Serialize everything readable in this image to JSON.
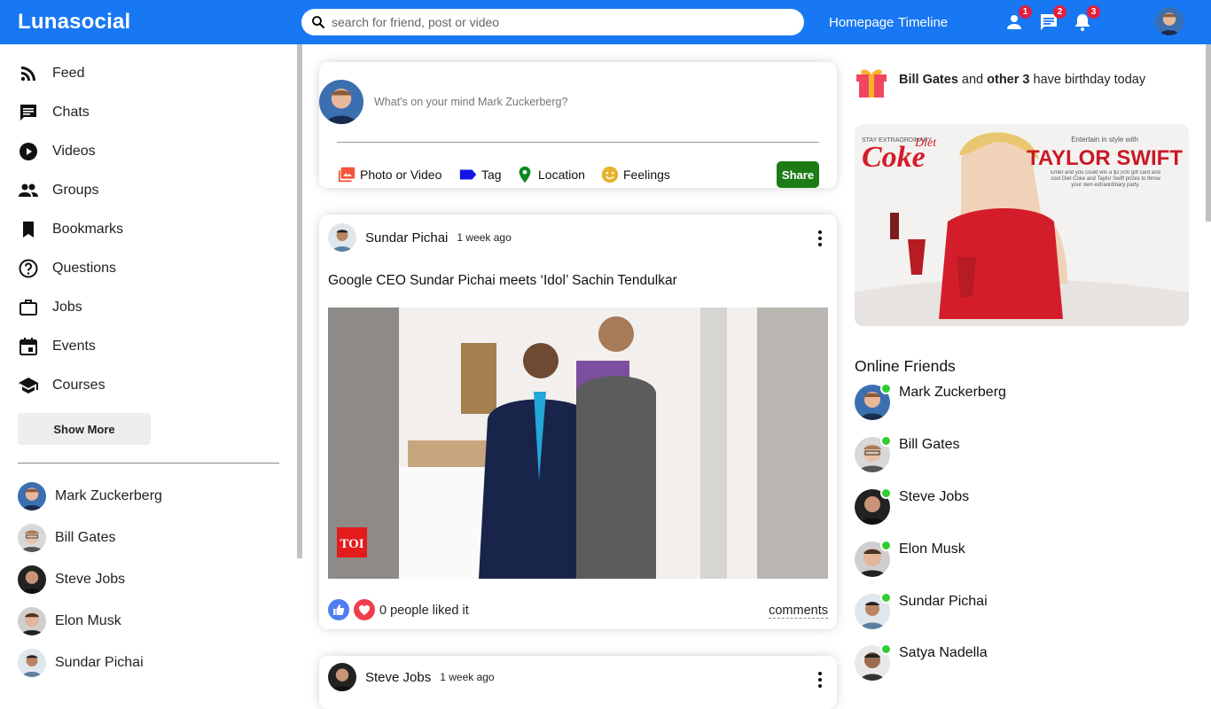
{
  "app": {
    "name": "Lunasocial"
  },
  "search": {
    "placeholder": "search for friend, post or video"
  },
  "topbar": {
    "links": [
      "Homepage",
      "Timeline"
    ],
    "badges": {
      "friends": "1",
      "messages": "2",
      "notifications": "3"
    }
  },
  "sidebar": {
    "items": [
      {
        "label": "Feed",
        "icon": "rss-feed-icon"
      },
      {
        "label": "Chats",
        "icon": "chat-icon"
      },
      {
        "label": "Videos",
        "icon": "play-circle-icon"
      },
      {
        "label": "Groups",
        "icon": "group-icon"
      },
      {
        "label": "Bookmarks",
        "icon": "bookmark-icon"
      },
      {
        "label": "Questions",
        "icon": "help-outline-icon"
      },
      {
        "label": "Jobs",
        "icon": "work-outline-icon"
      },
      {
        "label": "Events",
        "icon": "event-icon"
      },
      {
        "label": "Courses",
        "icon": "school-icon"
      }
    ],
    "show_more": "Show More",
    "friends": [
      "Mark Zuckerberg",
      "Bill Gates",
      "Steve Jobs",
      "Elon Musk",
      "Sundar Pichai"
    ]
  },
  "share": {
    "placeholder": "What's on your mind Mark Zuckerberg?",
    "options": [
      "Photo or Video",
      "Tag",
      "Location",
      "Feelings"
    ],
    "button": "Share"
  },
  "posts": [
    {
      "author": "Sundar Pichai",
      "date": "1 week ago",
      "text": "Google CEO Sundar Pichai meets ‘Idol’ Sachin Tendulkar",
      "image_badge": "TOI",
      "likes_text": "0 people liked it",
      "comments_label": "comments"
    },
    {
      "author": "Steve Jobs",
      "date": "1 week ago"
    }
  ],
  "birthday": {
    "name": "Bill Gates",
    "middle": " and ",
    "others": "other 3",
    "suffix": " have birthday today"
  },
  "ad": {
    "brand_top": "STAY EXTRAORDINARY",
    "brand_diet": "Diet",
    "brand": "Coke",
    "tagline": "Entertain in style with",
    "celebrity": "TAYLOR SWIFT",
    "body": "Enter and you could win a $2,500 gift card and cool Diet Coke and Taylor Swift prizes to throw your own extraordinary party."
  },
  "online": {
    "title": "Online Friends",
    "friends": [
      "Mark Zuckerberg",
      "Bill Gates",
      "Steve Jobs",
      "Elon Musk",
      "Sundar Pichai",
      "Satya Nadella"
    ]
  },
  "colors": {
    "topbar": "#1877f2",
    "share_button": "#1d7b16",
    "badge": "#e41e3f",
    "online_dot": "#32cd32"
  }
}
